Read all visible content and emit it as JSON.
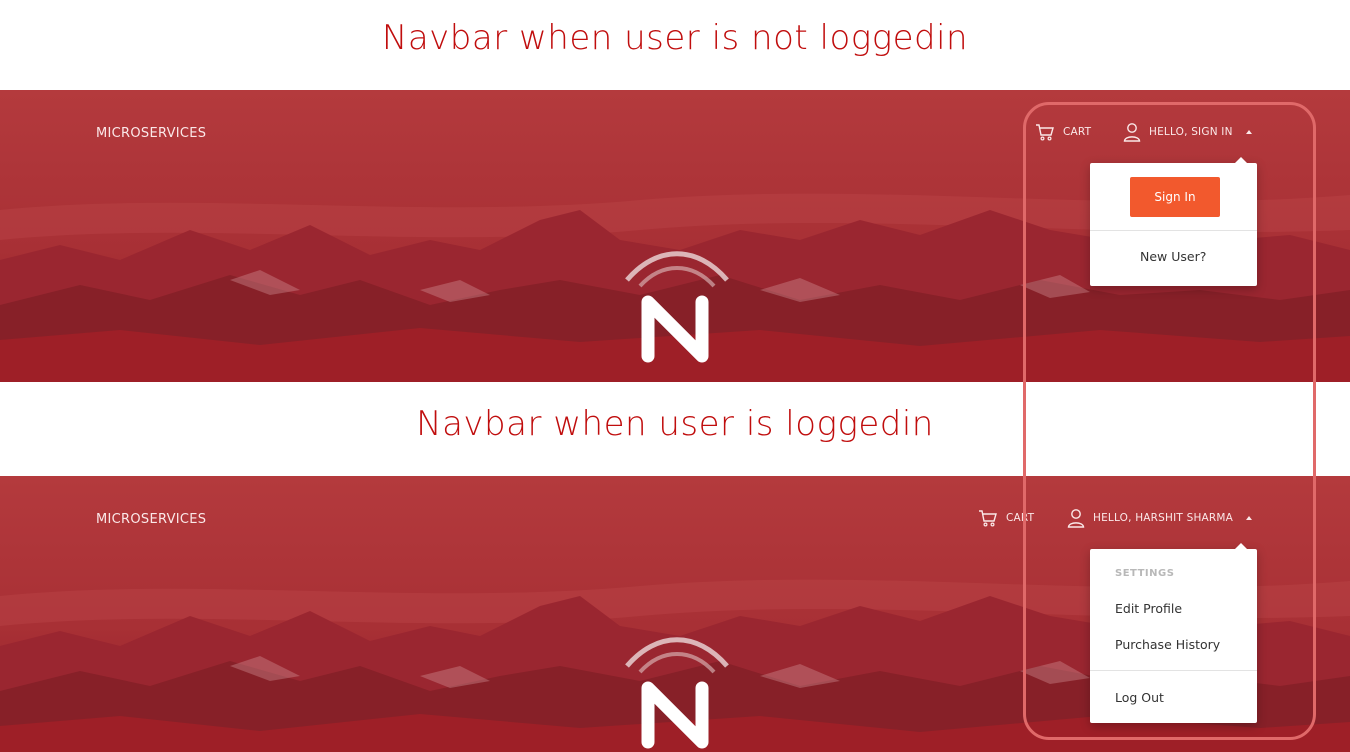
{
  "headings": {
    "logged_out": "Navbar when user is not loggedin",
    "logged_in": "Navbar when user is loggedin"
  },
  "navbar_logged_out": {
    "brand": "MICROSERVICES",
    "cart_label": "CART",
    "user_label": "HELLO, SIGN IN",
    "dropdown": {
      "sign_in_button": "Sign In",
      "new_user_link": "New User?"
    }
  },
  "navbar_logged_in": {
    "brand": "MICROSERVICES",
    "cart_label": "CART",
    "user_label": "HELLO, HARSHIT SHARMA",
    "dropdown": {
      "section_header": "SETTINGS",
      "items": [
        "Edit Profile",
        "Purchase History"
      ],
      "logout": "Log Out"
    }
  },
  "icons": {
    "cart": "cart-icon",
    "user": "user-icon",
    "caret": "caret-up-icon",
    "logo": "n-logo-icon"
  },
  "colors": {
    "heading_text": "#c00d0d",
    "hero_overlay": "#b3262b",
    "sign_in_button": "#f2592d",
    "highlight_border": "#e06969"
  }
}
